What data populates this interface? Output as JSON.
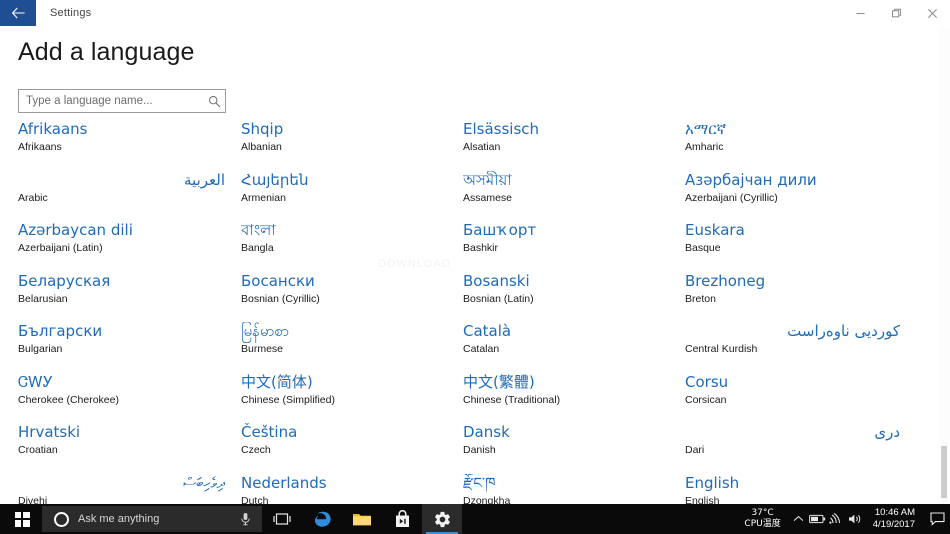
{
  "window": {
    "app_title": "Settings",
    "back_label": "Back",
    "minimize_label": "Minimize",
    "restore_label": "Restore",
    "close_label": "Close",
    "accent_color": "#1f4e93"
  },
  "page": {
    "title": "Add a language",
    "search_placeholder": "Type a language name...",
    "search_value": "",
    "link_color": "#1f6bb8",
    "watermark": "DOWNLOAD"
  },
  "languages": {
    "column1": [
      {
        "native": "Afrikaans",
        "english": "Afrikaans",
        "rtl": false
      },
      {
        "native": "العربية",
        "english": "Arabic",
        "rtl": true
      },
      {
        "native": "Azərbaycan dili",
        "english": "Azerbaijani (Latin)",
        "rtl": false
      },
      {
        "native": "Беларуская",
        "english": "Belarusian",
        "rtl": false
      },
      {
        "native": "Български",
        "english": "Bulgarian",
        "rtl": false
      },
      {
        "native": "ᏣᎳᎩ",
        "english": "Cherokee (Cherokee)",
        "rtl": false
      },
      {
        "native": "Hrvatski",
        "english": "Croatian",
        "rtl": false
      },
      {
        "native": "ދިވެހިބަސް",
        "english": "Divehi",
        "rtl": true
      }
    ],
    "column2": [
      {
        "native": "Shqip",
        "english": "Albanian",
        "rtl": false
      },
      {
        "native": "Հայերեն",
        "english": "Armenian",
        "rtl": false
      },
      {
        "native": "বাংলা",
        "english": "Bangla",
        "rtl": false
      },
      {
        "native": "Босански",
        "english": "Bosnian (Cyrillic)",
        "rtl": false
      },
      {
        "native": "မြန်မာစာ",
        "english": "Burmese",
        "rtl": false
      },
      {
        "native": "中文(简体)",
        "english": "Chinese (Simplified)",
        "rtl": false
      },
      {
        "native": "Čeština",
        "english": "Czech",
        "rtl": false
      },
      {
        "native": "Nederlands",
        "english": "Dutch",
        "rtl": false
      }
    ],
    "column3": [
      {
        "native": "Elsässisch",
        "english": "Alsatian",
        "rtl": false
      },
      {
        "native": "অসমীয়া",
        "english": "Assamese",
        "rtl": false
      },
      {
        "native": "Башҡорт",
        "english": "Bashkir",
        "rtl": false
      },
      {
        "native": "Bosanski",
        "english": "Bosnian (Latin)",
        "rtl": false
      },
      {
        "native": "Català",
        "english": "Catalan",
        "rtl": false
      },
      {
        "native": "中文(繁體)",
        "english": "Chinese (Traditional)",
        "rtl": false
      },
      {
        "native": "Dansk",
        "english": "Danish",
        "rtl": false
      },
      {
        "native": "རྫོང་ཁ",
        "english": "Dzongkha",
        "rtl": false
      }
    ],
    "column4": [
      {
        "native": "አማርኛ",
        "english": "Amharic",
        "rtl": false
      },
      {
        "native": "Азәрбајчан дили",
        "english": "Azerbaijani (Cyrillic)",
        "rtl": false
      },
      {
        "native": "Euskara",
        "english": "Basque",
        "rtl": false
      },
      {
        "native": "Brezhoneg",
        "english": "Breton",
        "rtl": false
      },
      {
        "native": "کوردیی ناوەراست",
        "english": "Central Kurdish",
        "rtl": true
      },
      {
        "native": "Corsu",
        "english": "Corsican",
        "rtl": false
      },
      {
        "native": "دری",
        "english": "Dari",
        "rtl": true
      },
      {
        "native": "English",
        "english": "English",
        "rtl": false
      }
    ]
  },
  "taskbar": {
    "start_label": "Start",
    "cortana_placeholder": "Ask me anything",
    "mic_label": "Microphone",
    "taskview_label": "Task View",
    "edge_label": "Microsoft Edge",
    "explorer_label": "File Explorer",
    "store_label": "Microsoft Store",
    "settings_label": "Settings",
    "tray": {
      "cpu_temp": "37°C",
      "cpu_label": "CPU温度",
      "chevron_label": "Show hidden icons",
      "battery_label": "Battery",
      "network_label": "Network",
      "volume_label": "Volume",
      "time": "10:46 AM",
      "date": "4/19/2017",
      "action_center_label": "Action Center"
    }
  }
}
